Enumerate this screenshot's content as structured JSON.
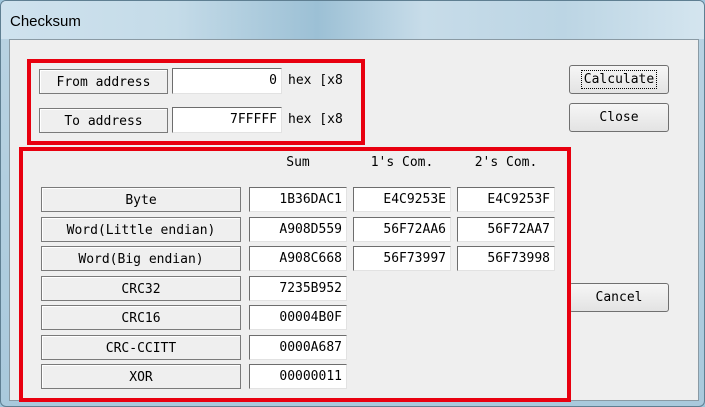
{
  "window": {
    "title": "Checksum"
  },
  "address": {
    "from_label": "From address",
    "from_value": "0",
    "to_label": "To address",
    "to_value": "7FFFFF",
    "unit": "hex [x8"
  },
  "buttons": {
    "calculate": "Calculate",
    "close": "Close",
    "cancel": "Cancel"
  },
  "table": {
    "headers": [
      "Sum",
      "1's Com.",
      "2's Com."
    ],
    "rows": [
      {
        "label": "Byte",
        "sum": "1B36DAC1",
        "ones": "E4C9253E",
        "twos": "E4C9253F"
      },
      {
        "label": "Word(Little endian)",
        "sum": "A908D559",
        "ones": "56F72AA6",
        "twos": "56F72AA7"
      },
      {
        "label": "Word(Big endian)",
        "sum": "A908C668",
        "ones": "56F73997",
        "twos": "56F73998"
      },
      {
        "label": "CRC32",
        "sum": "7235B952"
      },
      {
        "label": "CRC16",
        "sum": "00004B0F"
      },
      {
        "label": "CRC-CCITT",
        "sum": "0000A687"
      },
      {
        "label": "XOR",
        "sum": "00000011"
      }
    ]
  },
  "colors": {
    "highlight": "#e8000f"
  }
}
